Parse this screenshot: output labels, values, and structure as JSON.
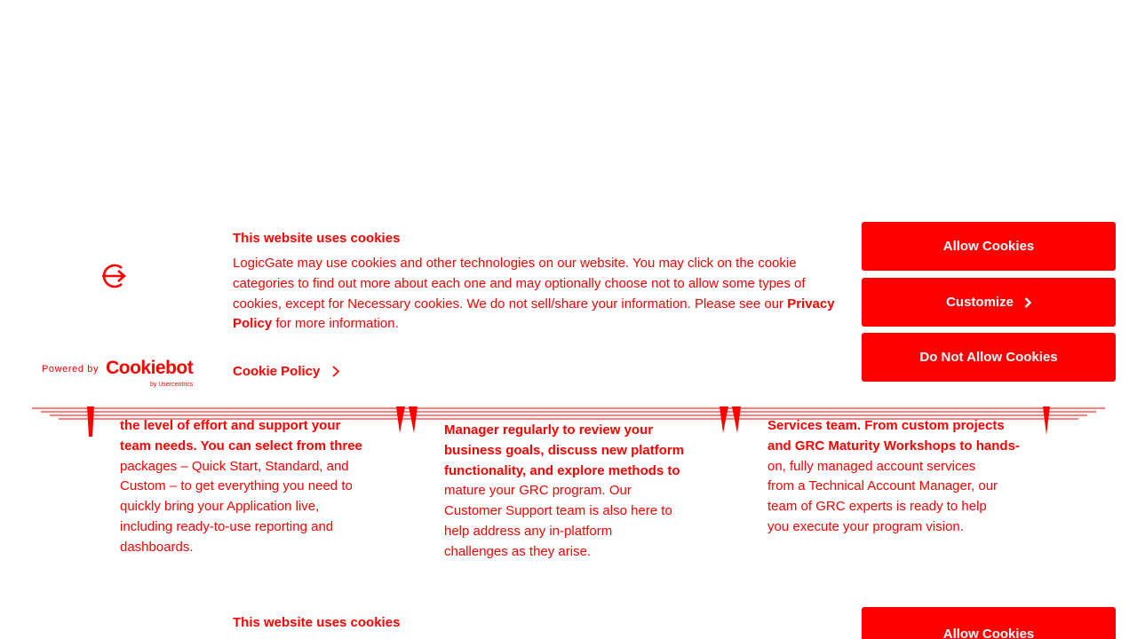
{
  "background": {
    "columns": [
      {
        "lines": [
          "the level of effort and support your",
          "team needs. You can select from three",
          "packages – Quick Start, Standard, and",
          "Custom – to get everything you need to",
          "quickly bring your Application live,",
          "including ready-to-use reporting and",
          "dashboards."
        ],
        "bold_line_count": 2
      },
      {
        "lines": [
          "Manager regularly to review your",
          "business goals, discuss new platform",
          "functionality, and explore methods to",
          "mature your GRC program. Our",
          "Customer Support team is also here to",
          "help address any in-platform",
          "challenges as they arise."
        ],
        "bold_line_count": 3
      },
      {
        "lines": [
          "Services team. From custom projects",
          "and GRC Maturity Workshops to hands-",
          "on, fully managed account services",
          "from a Technical Account Manager, our",
          "team of GRC experts is ready to help",
          "you execute your program vision."
        ],
        "bold_line_count": 2
      }
    ]
  },
  "banner": {
    "title": "This website uses cookies",
    "text_before_link": "LogicGate may use cookies and other technologies on our website. You may click on the cookie categories to find out more about each one and may optionally choose not to allow some types of cookies, except for Necessary cookies.  We do not sell/share your information. Please see our ",
    "privacy_link": "Privacy Policy",
    "text_after_link": " for more information.",
    "cookie_policy_label": "Cookie Policy",
    "powered_by_label": "Powered by",
    "cookiebot_word": "Cookiebot",
    "cookiebot_sub": "by Usercentrics",
    "buttons": {
      "allow": "Allow Cookies",
      "customize": "Customize",
      "deny": "Do Not Allow Cookies"
    }
  },
  "banner_repeat": {
    "title": "This website uses cookies",
    "allow": "Allow Cookies"
  },
  "colors": {
    "accent": "#ff0000",
    "background": "#ffffff",
    "button_text": "#ffffff"
  },
  "icons": {
    "logo": "logicgate-logo-icon",
    "cookie_policy_arrow": "chevron-right-icon",
    "customize_arrow": "chevron-right-icon"
  }
}
